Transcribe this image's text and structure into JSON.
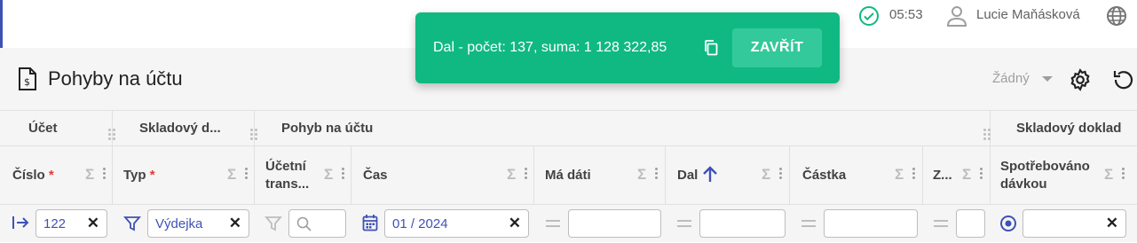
{
  "topbar": {
    "time": "05:53",
    "user_name": "Lucie Maňásková"
  },
  "page": {
    "title": "Pohyby na účtu",
    "view_selector": "Žádný"
  },
  "toast": {
    "message": "Dal - počet: 137, suma: 1 128 322,85",
    "close_label": "ZAVŘÍT",
    "color": "#10b981"
  },
  "grid": {
    "groups": [
      "Účet",
      "Skladový d...",
      "Pohyb na účtu",
      "Skladový doklad"
    ],
    "columns": [
      {
        "label": "Číslo",
        "required": "*"
      },
      {
        "label": "Typ",
        "required": "*"
      },
      {
        "label_line1": "Účetní",
        "label_line2": "trans..."
      },
      {
        "label": "Čas"
      },
      {
        "label": "Má dáti"
      },
      {
        "label": "Dal"
      },
      {
        "label": "Částka"
      },
      {
        "label": "Z..."
      },
      {
        "label_line1": "Spotřebováno",
        "label_line2": "dávkou"
      }
    ],
    "filters": {
      "cislo": "122",
      "typ": "Výdejka",
      "cas": "01 / 2024"
    }
  },
  "accent_color": "#3f51b5"
}
